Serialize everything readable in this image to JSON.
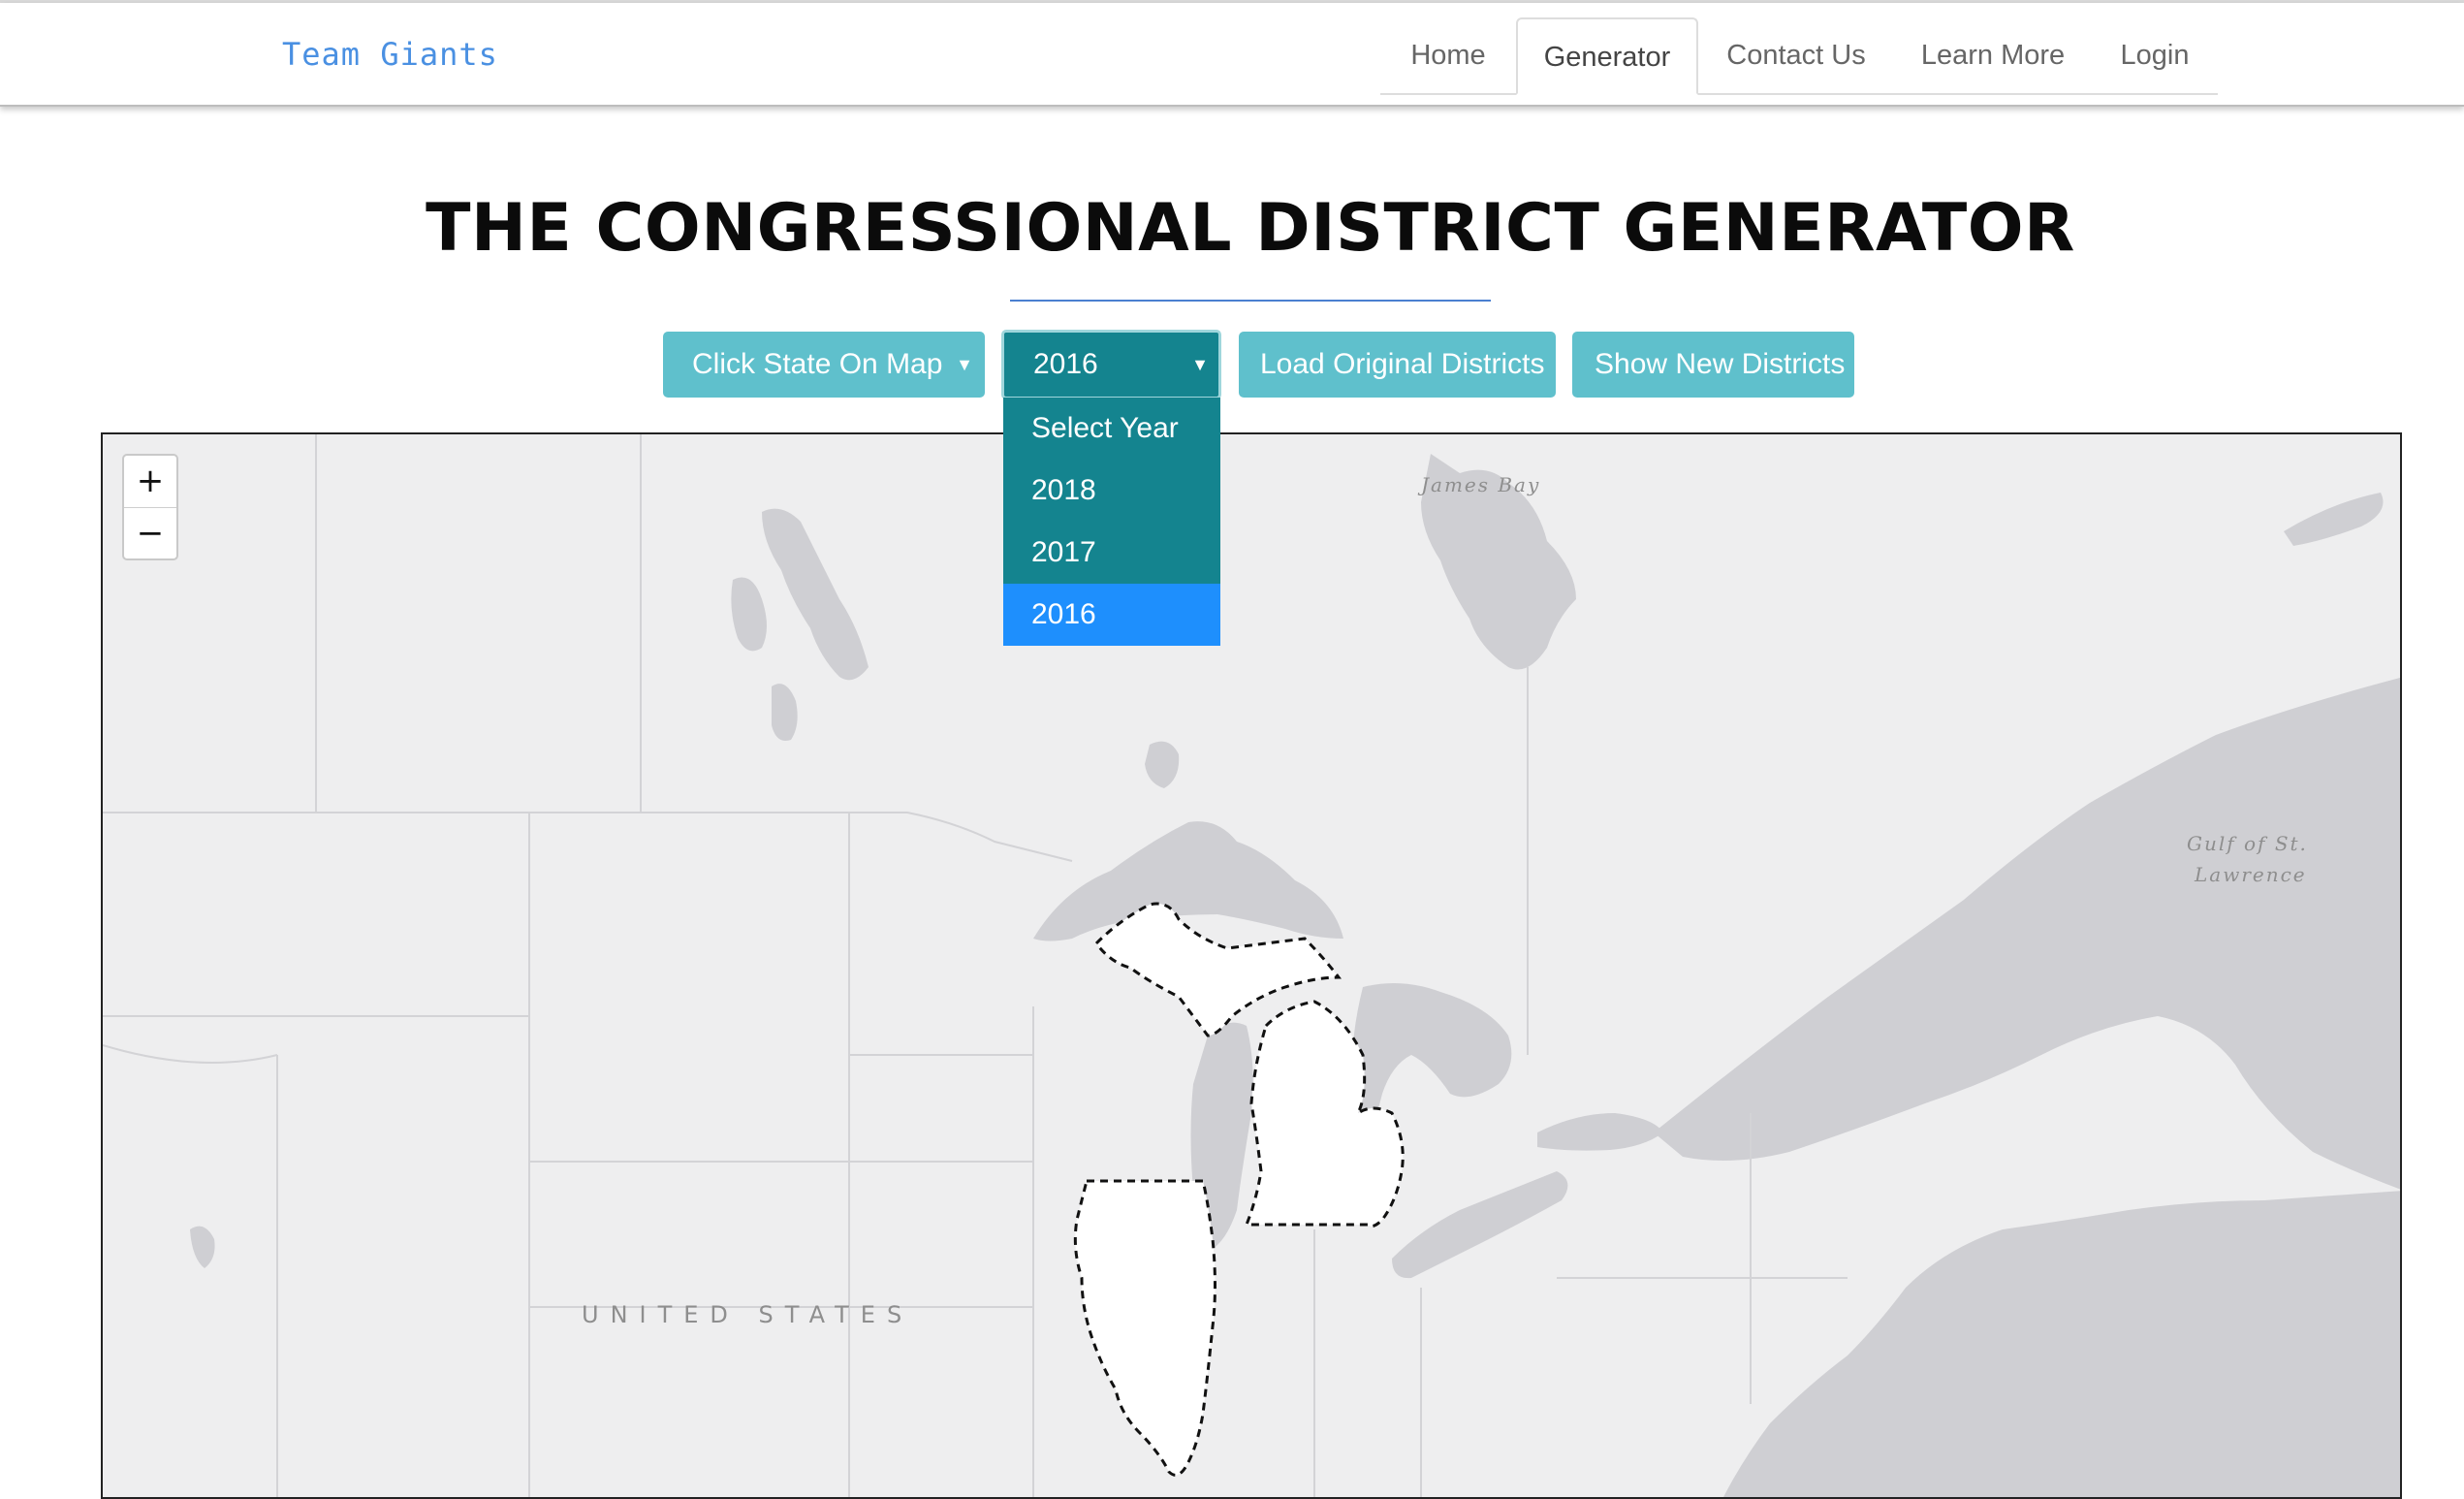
{
  "nav": {
    "brand": "Team Giants",
    "tabs": [
      {
        "label": "Home",
        "active": false
      },
      {
        "label": "Generator",
        "active": true
      },
      {
        "label": "Contact Us",
        "active": false
      },
      {
        "label": "Learn More",
        "active": false
      },
      {
        "label": "Login",
        "active": false
      }
    ]
  },
  "header": {
    "title": "THE CONGRESSIONAL DISTRICT GENERATOR"
  },
  "controls": {
    "state_select": {
      "label": "Click State On Map",
      "caret": "▼"
    },
    "year_select": {
      "value": "2016",
      "caret": "▼",
      "options": [
        "Select Year",
        "2018",
        "2017",
        "2016"
      ],
      "highlighted": "2016"
    },
    "load_button": "Load Original Districts",
    "show_button": "Show New Districts"
  },
  "map": {
    "zoom_in": "+",
    "zoom_out": "−",
    "labels": {
      "country": "UNITED STATES",
      "james_bay": "James Bay",
      "gulf_line1": "Gulf of St.",
      "gulf_line2": "Lawrence"
    },
    "highlighted_states": [
      "Michigan",
      "Illinois"
    ],
    "colors": {
      "land": "#eeeeef",
      "water": "#cfcfd3",
      "border": "#d5d5d8",
      "highlight": "#ffffff",
      "outline": "#111111"
    }
  }
}
